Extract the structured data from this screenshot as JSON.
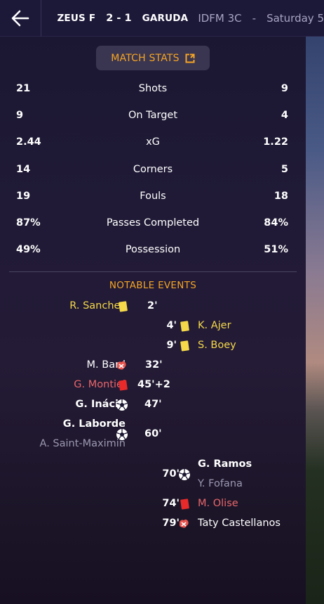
{
  "header": {
    "home_team": "ZEUS F",
    "score": "2 - 1",
    "away_team": "GARUDA",
    "competition": "IDFM 3C",
    "separator": "-",
    "date": "Saturday 5"
  },
  "stats_button": {
    "label": "MATCH STATS"
  },
  "stats": [
    {
      "name": "Shots",
      "home": "21",
      "away": "9"
    },
    {
      "name": "On Target",
      "home": "9",
      "away": "4"
    },
    {
      "name": "xG",
      "home": "2.44",
      "away": "1.22"
    },
    {
      "name": "Corners",
      "home": "14",
      "away": "5"
    },
    {
      "name": "Fouls",
      "home": "19",
      "away": "18"
    },
    {
      "name": "Passes Completed",
      "home": "87%",
      "away": "84%"
    },
    {
      "name": "Possession",
      "home": "49%",
      "away": "51%"
    }
  ],
  "events_title": "NOTABLE EVENTS",
  "events": [
    {
      "minute": "2'",
      "player": "R. Sanches"
    },
    {
      "minute": "4'",
      "player": "K. Ajer"
    },
    {
      "minute": "9'",
      "player": "S. Boey"
    },
    {
      "minute": "32'",
      "player": "M. Bard"
    },
    {
      "minute": "45'+2",
      "player": "G. Montiel"
    },
    {
      "minute": "47'",
      "player": "G. Inácio"
    },
    {
      "minute": "60'",
      "player": "G. Laborde",
      "assist": "A. Saint-Maximin"
    },
    {
      "minute": "70'",
      "player": "G. Ramos",
      "assist": "Y. Fofana"
    },
    {
      "minute": "74'",
      "player": "M. Olise"
    },
    {
      "minute": "79'",
      "player": "Taty Castellanos"
    }
  ],
  "colors": {
    "accent": "#f5a524",
    "yellow_card": "#f5d94a",
    "red_card": "#e82a2a",
    "red_text": "#e8666a"
  },
  "icons": {
    "back": "arrow-left-icon",
    "expand": "expand-icon",
    "yellow_card": "yellow-card-icon",
    "red_card": "red-card-icon",
    "goal": "football-icon",
    "injury": "injury-icon"
  }
}
